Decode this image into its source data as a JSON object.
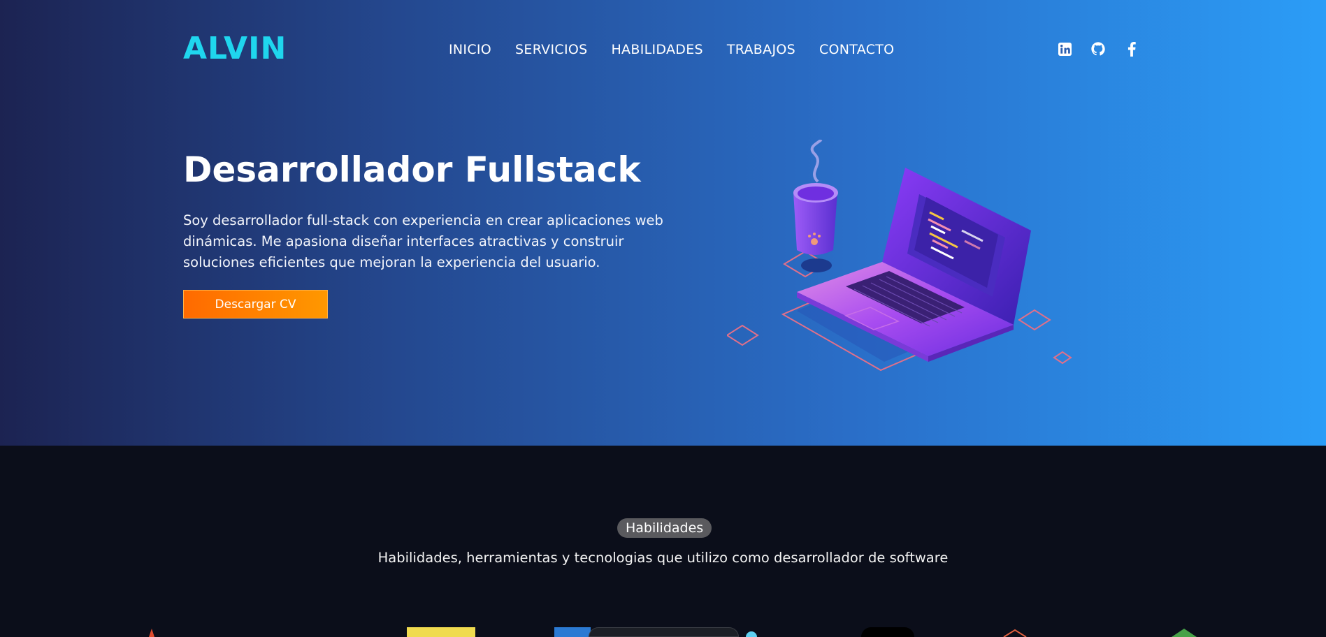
{
  "header": {
    "logo": "ALVIN",
    "nav": [
      "INICIO",
      "SERVICIOS",
      "HABILIDADES",
      "TRABAJOS",
      "CONTACTO"
    ],
    "socials": [
      "linkedin-icon",
      "github-icon",
      "facebook-icon"
    ]
  },
  "hero": {
    "title": "Desarrollador Fullstack",
    "lines": [
      "Soy desarrollador full-stack con experiencia en crear aplicaciones web",
      "dinámicas. Me apasiona diseñar interfaces atractivas y construir",
      "soluciones eficientes que mejoran la experiencia del usuario."
    ],
    "cta": "Descargar CV"
  },
  "skills": {
    "badge": "Habilidades",
    "subtitle": "Habilidades, herramientas y tecnologias que utilizo como desarrollador de software"
  },
  "colors": {
    "logo": "#1fd6ee",
    "cta_start": "#ff6a00",
    "cta_end": "#ff9800",
    "hero_left": "#1c2352",
    "hero_right": "#2b9df7",
    "section_bg": "#0b0e1a"
  }
}
